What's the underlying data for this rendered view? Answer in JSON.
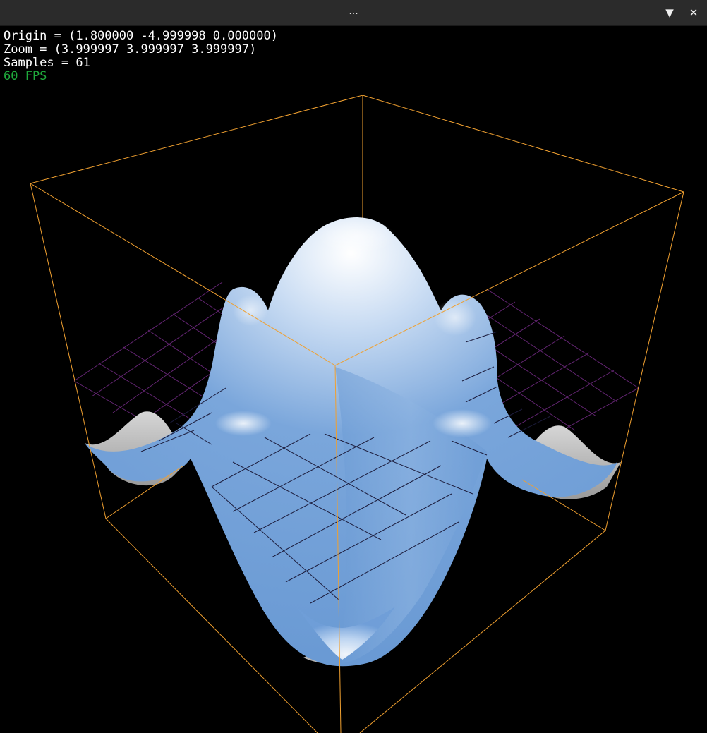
{
  "window": {
    "title": "...",
    "minimize_label": "▼",
    "close_label": "✕"
  },
  "hud": {
    "origin": "Origin = (1.800000 -4.999998 0.000000)",
    "zoom": "Zoom = (3.999997 3.999997 3.999997)",
    "samples": "Samples = 61",
    "fps": "60 FPS"
  },
  "colors": {
    "background": "#000000",
    "bounding_box": "#f0a030",
    "surface": "#6f9ed8",
    "surface_highlight": "#ffffff",
    "surface_underside": "#b4b4b4",
    "grid_floor": "#7a2e8c",
    "grid_on_surface": "#1a1a3a",
    "fps_text": "#1faa3c"
  }
}
